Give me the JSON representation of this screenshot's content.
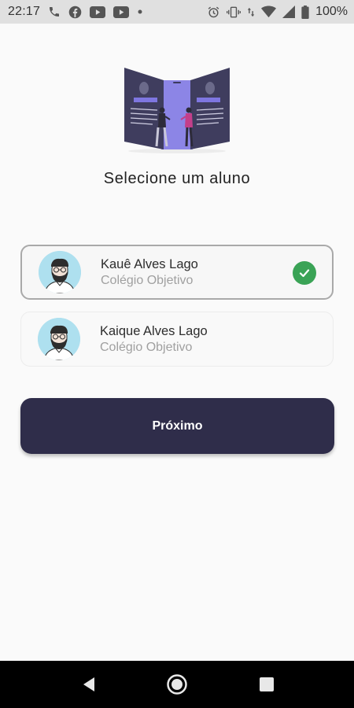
{
  "status_bar": {
    "time": "22:17",
    "left_icons": [
      "phone-icon",
      "facebook-icon",
      "youtube-icon",
      "youtube-icon",
      "dot-icon"
    ],
    "right_icons": [
      "alarm-icon",
      "vibrate-icon",
      "data-arrows-icon",
      "wifi-icon",
      "signal-icon",
      "battery-icon"
    ],
    "battery": "100%"
  },
  "page": {
    "title": "Selecione um aluno"
  },
  "students": [
    {
      "name": "Kauê Alves Lago",
      "school": "Colégio Objetivo",
      "selected": true
    },
    {
      "name": "Kaique Alves Lago",
      "school": "Colégio Objetivo",
      "selected": false
    }
  ],
  "actions": {
    "next_label": "Próximo"
  },
  "colors": {
    "button": "#2f2d4a",
    "check": "#3aa356",
    "avatar_bg": "#aee0ef",
    "background": "#fafafa"
  }
}
